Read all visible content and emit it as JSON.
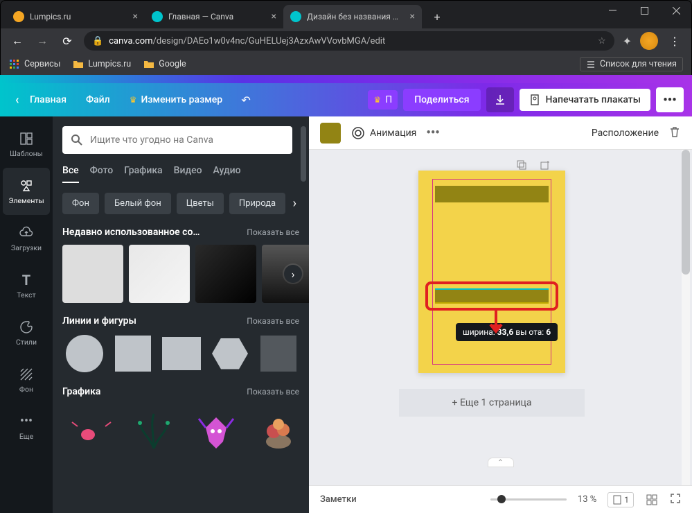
{
  "browser": {
    "tabs": [
      {
        "title": "Lumpics.ru",
        "favicon": "#f5a623"
      },
      {
        "title": "Главная — Canva",
        "favicon": "#00c4cc"
      },
      {
        "title": "Дизайн без названия — Плака",
        "favicon": "#00c4cc",
        "active": true
      }
    ],
    "url_domain": "canva.com",
    "url_path": "/design/DAEo1w0v4nc/GuHELUej3AzxAwVVovbMGA/edit",
    "bookmarks": {
      "services": "Сервисы",
      "lumpics": "Lumpics.ru",
      "google": "Google",
      "reading_list": "Список для чтения"
    }
  },
  "header": {
    "home": "Главная",
    "file": "Файл",
    "resize": "Изменить размер",
    "premium_short": "П",
    "share": "Поделиться",
    "print": "Напечатать плакаты",
    "more": "•••"
  },
  "rail": {
    "templates": "Шаблоны",
    "elements": "Элементы",
    "uploads": "Загрузки",
    "text": "Текст",
    "styles": "Стили",
    "background": "Фон",
    "more": "Еще"
  },
  "panel": {
    "search_placeholder": "Ищите что угодно на Canva",
    "filters": {
      "all": "Все",
      "photo": "Фото",
      "graphics": "Графика",
      "video": "Видео",
      "audio": "Аудио"
    },
    "chips": {
      "bg": "Фон",
      "white_bg": "Белый фон",
      "flowers": "Цветы",
      "nature": "Природа"
    },
    "recent_title": "Недавно использованное со…",
    "show_all": "Показать все",
    "lines_title": "Линии и фигуры",
    "graphics_title": "Графика"
  },
  "toolbar": {
    "animation": "Анимация",
    "more": "•••",
    "arrange": "Расположение"
  },
  "tooltip": {
    "width_label": "ширина:",
    "width_val": "33,6",
    "height_label": "вы ота:",
    "height_val": "6"
  },
  "add_page": "+ Еще 1 страница",
  "bottom": {
    "notes": "Заметки",
    "zoom": "13 %",
    "page": "1"
  }
}
